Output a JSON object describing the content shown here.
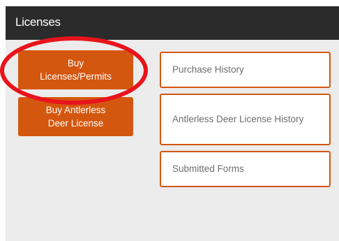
{
  "header": {
    "title": "Licenses"
  },
  "actions": {
    "buy": {
      "line1": "Buy",
      "line2": "Licenses/Permits"
    },
    "antlerless": {
      "line1": "Buy Antlerless",
      "line2": "Deer License"
    }
  },
  "links": {
    "purchase_history": "Purchase History",
    "antlerless_history": "Antlerless Deer License History",
    "submitted_forms": "Submitted Forms"
  },
  "colors": {
    "accent": "#d4570f",
    "header_bg": "#2b2b2b",
    "annotation": "#e8141c"
  }
}
